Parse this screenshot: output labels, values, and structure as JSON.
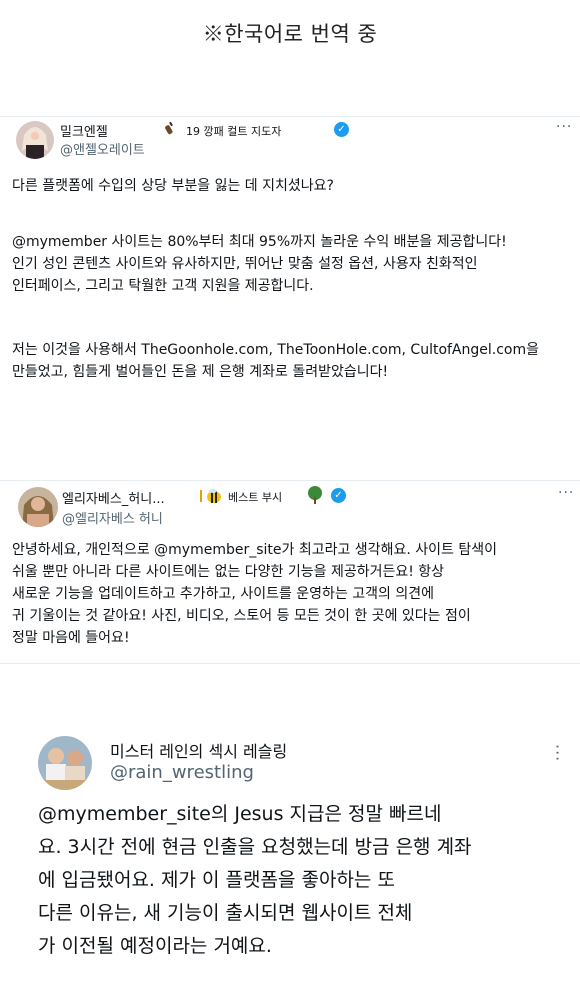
{
  "banner": "※한국어로 번역 중",
  "tweets": [
    {
      "name": "밀크엔젤",
      "handle": "@앤젤오레이트",
      "badge": "19 깡패 컬트 지도자",
      "lines": [
        "다른 플랫폼에 수입의 상당 부분을 잃는 데 지치셨나요?",
        "",
        "@mymember 사이트는 80%부터 최대 95%까지 놀라운 수익 배분을 제공합니다!",
        "인기 성인 콘텐츠 사이트와 유사하지만, 뛰어난 맞춤 설정 옵션, 사용자 친화적인",
        "인터페이스, 그리고 탁월한 고객 지원을 제공합니다.",
        "",
        "저는 이것을 사용해서 TheGoonhole.com, TheToonHole.com, CultofAngel.com을",
        "만들었고, 힘들게 벌어들인 돈을 제 은행 계좌로 돌려받았습니다!"
      ]
    },
    {
      "name": "엘리자베스_허니...",
      "handle": "@엘리자베스 허니",
      "badge": "베스트 부시",
      "lines": [
        "안녕하세요, 개인적으로 @mymember_site가 최고라고 생각해요. 사이트 탐색이",
        "쉬울 뿐만 아니라 다른 사이트에는 없는 다양한 기능을 제공하거든요! 항상",
        "새로운 기능을 업데이트하고 추가하고, 사이트를 운영하는 고객의 의견에",
        "귀 기울이는 것 같아요! 사진, 비디오, 스토어 등 모든 것이 한 곳에 있다는 점이",
        "정말 마음에 들어요!"
      ]
    },
    {
      "name": "미스터 레인의 섹시 레슬링",
      "handle": "@rain_wrestling",
      "lines": [
        "@mymember_site의 Jesus 지급은 정말 빠르네",
        "요. 3시간 전에 현금 인출을 요청했는데 방금 은행 계좌",
        "에 입금됐어요. 제가 이 플랫폼을 좋아하는 또",
        "다른 이유는, 새 기능이 출시되면 웹사이트 전체",
        "가 이전될 예정이라는 거예요."
      ]
    }
  ],
  "colors": {
    "verified": "#1d9bf0",
    "handle": "#536471"
  },
  "icons": [
    "verified-badge-icon",
    "more-options-icon",
    "bottle-icon",
    "bee-icon",
    "tree-icon"
  ]
}
